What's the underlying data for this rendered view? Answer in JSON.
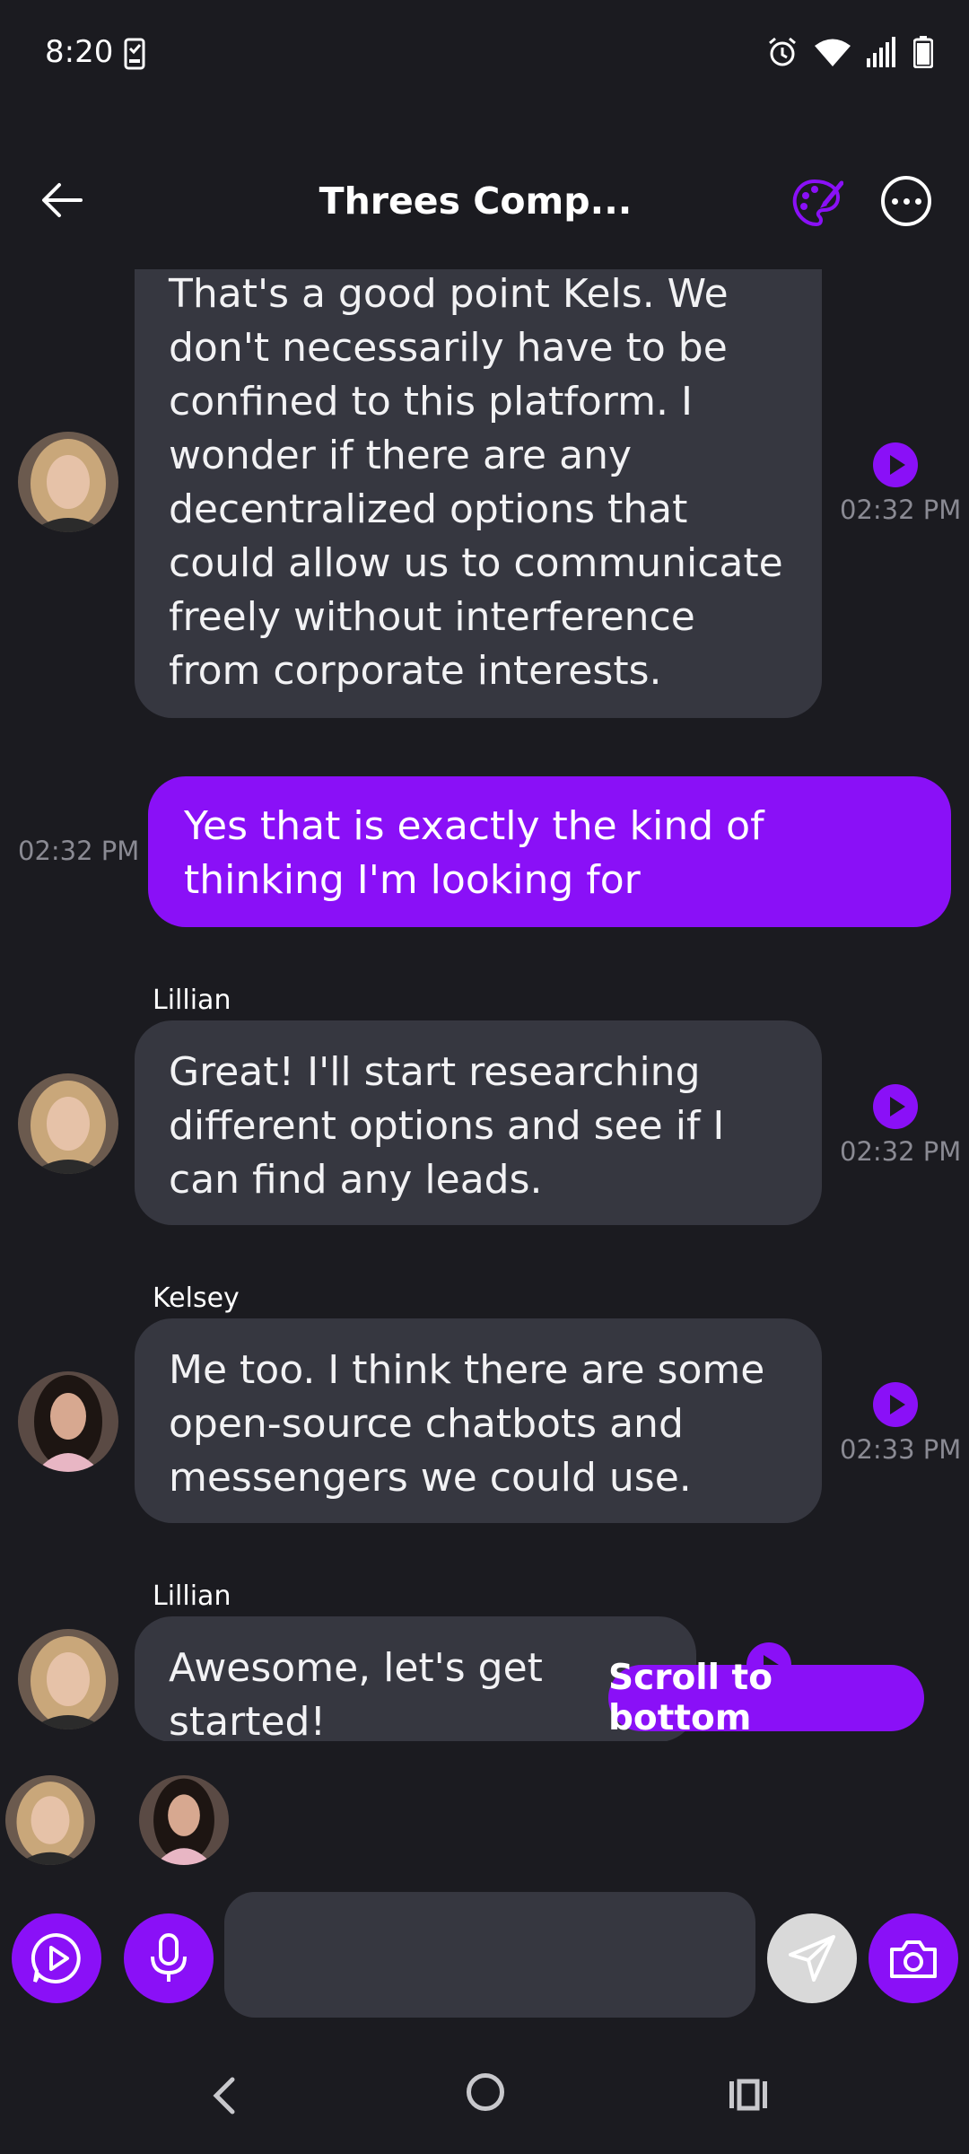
{
  "status_bar": {
    "time": "8:20"
  },
  "header": {
    "title": "Threes Comp...",
    "back_icon": "arrow-left-icon",
    "theme_icon": "palette-icon",
    "menu_icon": "more-horizontal-icon"
  },
  "messages": [
    {
      "direction": "incoming",
      "sender": "",
      "text": "That's a good point Kels. We don't necessarily have to be confined to this platform. I wonder if there are any decentralized options that could allow us to communicate freely without interference from corporate interests.",
      "time": "02:32 PM"
    },
    {
      "direction": "outgoing",
      "text": "Yes that is exactly the kind of thinking I'm looking for",
      "time": "02:32 PM"
    },
    {
      "direction": "incoming",
      "sender": "Lillian",
      "text": "Great! I'll start researching different options and see if I can find any leads.",
      "time": "02:32 PM"
    },
    {
      "direction": "incoming",
      "sender": "Kelsey",
      "text": "Me too. I think there are some open-source chatbots and messengers we could use.",
      "time": "02:33 PM"
    },
    {
      "direction": "incoming",
      "sender": "Lillian",
      "text": "Awesome, let's get started!",
      "time": ""
    }
  ],
  "scroll_button": {
    "label": "Scroll to bottom"
  },
  "input": {
    "placeholder": "",
    "value": ""
  },
  "colors": {
    "accent": "#8a10f7",
    "background": "#1b1b20",
    "bubble_incoming": "#363740"
  }
}
